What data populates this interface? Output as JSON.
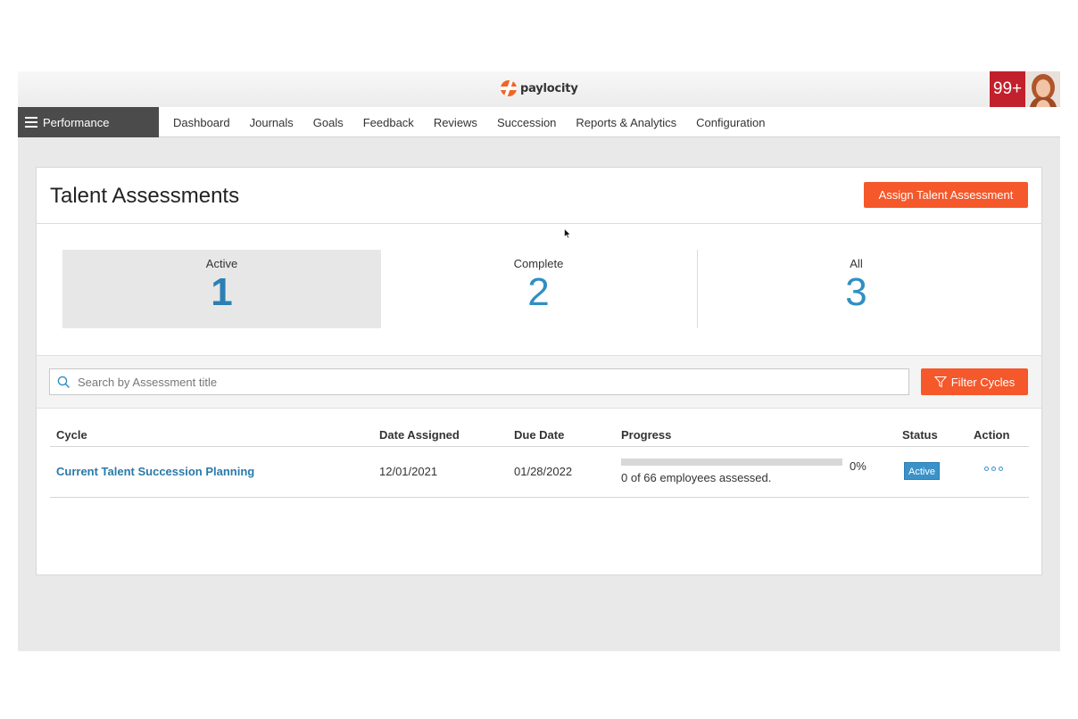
{
  "brand": {
    "logo_text": "paylocity",
    "accent": "#f4582b",
    "link": "#2a7aa8"
  },
  "header": {
    "notification_count": "99+"
  },
  "nav": {
    "module_label": "Performance",
    "links": [
      "Dashboard",
      "Journals",
      "Goals",
      "Feedback",
      "Reviews",
      "Succession",
      "Reports & Analytics",
      "Configuration"
    ]
  },
  "page": {
    "title": "Talent Assessments",
    "assign_button": "Assign Talent Assessment"
  },
  "stats": [
    {
      "label": "Active",
      "value": "1"
    },
    {
      "label": "Complete",
      "value": "2"
    },
    {
      "label": "All",
      "value": "3"
    }
  ],
  "search": {
    "placeholder": "Search by Assessment title",
    "value": ""
  },
  "filter": {
    "label": "Filter Cycles"
  },
  "table": {
    "headers": {
      "cycle": "Cycle",
      "date_assigned": "Date Assigned",
      "due_date": "Due Date",
      "progress": "Progress",
      "status": "Status",
      "action": "Action"
    },
    "rows": [
      {
        "cycle": "Current Talent Succession Planning",
        "date_assigned": "12/01/2021",
        "due_date": "01/28/2022",
        "progress_percent": 0,
        "progress_label": "0%",
        "progress_text": "0 of 66 employees assessed.",
        "status": "Active"
      }
    ]
  }
}
